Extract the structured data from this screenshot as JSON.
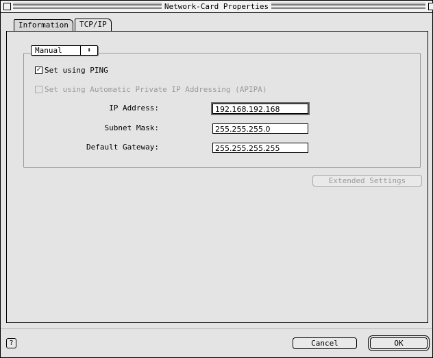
{
  "window": {
    "title": "Network-Card Properties"
  },
  "tabs": [
    {
      "label": "Information",
      "active": false
    },
    {
      "label": "TCP/IP",
      "active": true
    }
  ],
  "config": {
    "method_selected": "Manual",
    "ping": {
      "label": "Set using PING",
      "checked": true,
      "enabled": true
    },
    "apipa": {
      "label": "Set using Automatic Private IP Addressing (APIPA)",
      "checked": false,
      "enabled": false
    },
    "ip_label": "IP Address:",
    "ip_value": "192.168.192.168",
    "subnet_label": "Subnet Mask:",
    "subnet_value": "255.255.255.0",
    "gateway_label": "Default Gateway:",
    "gateway_value": "255.255.255.255"
  },
  "extended_settings_label": "Extended Settings",
  "footer": {
    "help_icon": "question-icon",
    "cancel_label": "Cancel",
    "ok_label": "OK"
  }
}
